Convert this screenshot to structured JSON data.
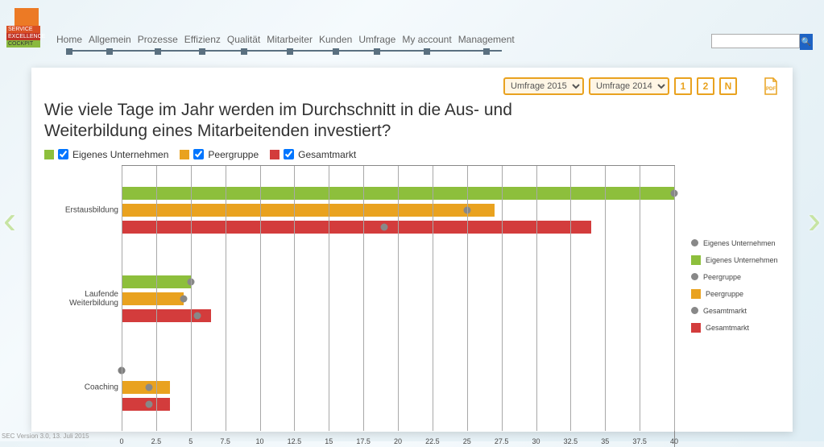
{
  "brand": {
    "l1": "SERVICE",
    "l2": "EXCELLENCE",
    "l3": "COCKPIT"
  },
  "nav": {
    "home": "Home",
    "allgemein": "Allgemein",
    "prozesse": "Prozesse",
    "effizienz": "Effizienz",
    "qualitaet": "Qualität",
    "mitarbeiter": "Mitarbeiter",
    "kunden": "Kunden",
    "umfrage": "Umfrage",
    "account": "My account",
    "management": "Management"
  },
  "search": {
    "placeholder": ""
  },
  "toolbar": {
    "survey_a": "Umfrage 2015",
    "survey_b": "Umfrage 2014",
    "one": "1",
    "two": "2",
    "n": "N",
    "pdf": "PDF"
  },
  "title": "Wie viele Tage im Jahr werden im Durchschnitt in die Aus- und Weiterbildung eines Mitarbeitenden investiert?",
  "filters": {
    "eigenes": "Eigenes Unternehmen",
    "peergruppe": "Peergruppe",
    "gesamtmarkt": "Gesamtmarkt"
  },
  "legend_right": {
    "eig_dot": "Eigenes Unternehmen",
    "eig_bar": "Eigenes Unternehmen",
    "pg_dot": "Peergruppe",
    "pg_bar": "Peergruppe",
    "gm_dot": "Gesamtmarkt",
    "gm_bar": "Gesamtmarkt"
  },
  "colors": {
    "eigenes": "#8dbf3c",
    "peergruppe": "#e9a21f",
    "gesamtmarkt": "#d33c3c",
    "dot": "#7f7f7f"
  },
  "version": "SEC Version 3.0, 13. Juli 2015",
  "chart_data": {
    "type": "bar",
    "title": "Wie viele Tage im Jahr werden im Durchschnitt in die Aus- und Weiterbildung eines Mitarbeitenden investiert?",
    "xlabel": "",
    "ylabel": "",
    "xlim": [
      0,
      40
    ],
    "xticks": [
      0,
      2.5,
      5,
      7.5,
      10,
      12.5,
      15,
      17.5,
      20,
      22.5,
      25,
      27.5,
      30,
      32.5,
      35,
      37.5,
      40
    ],
    "categories": [
      "Erstausbildung",
      "Laufende Weiterbildung",
      "Coaching"
    ],
    "series": [
      {
        "name": "Eigenes Unternehmen",
        "color": "#8dbf3c",
        "values_2015": [
          40,
          5,
          0
        ],
        "values_2014": [
          40,
          5,
          0
        ]
      },
      {
        "name": "Peergruppe",
        "color": "#e9a21f",
        "values_2015": [
          27,
          4.5,
          3.5
        ],
        "values_2014": [
          25,
          4.5,
          2
        ]
      },
      {
        "name": "Gesamtmarkt",
        "color": "#d33c3c",
        "values_2015": [
          34,
          6.5,
          3.5
        ],
        "values_2014": [
          19,
          5.5,
          2
        ]
      }
    ],
    "grid": true,
    "legend_position": "right"
  }
}
